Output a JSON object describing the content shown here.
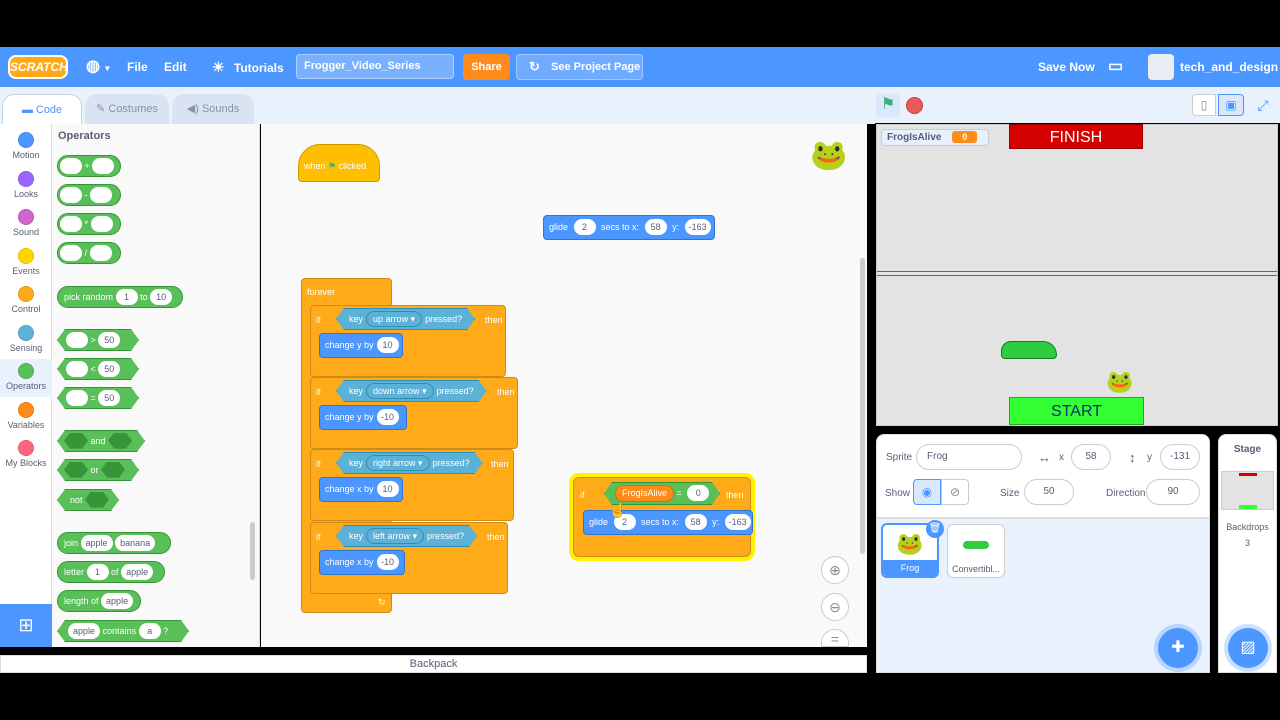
{
  "menubar": {
    "logo": "SCRATCH",
    "file": "File",
    "edit": "Edit",
    "tutorials": "Tutorials",
    "project_title": "Frogger_Video_Series",
    "share": "Share",
    "see_project": "See Project Page",
    "save_now": "Save Now",
    "username": "tech_and_design"
  },
  "tabs": {
    "code": "Code",
    "costumes": "Costumes",
    "sounds": "Sounds"
  },
  "categories": [
    {
      "label": "Motion",
      "color": "#4c97ff"
    },
    {
      "label": "Looks",
      "color": "#9966ff"
    },
    {
      "label": "Sound",
      "color": "#cf63cf"
    },
    {
      "label": "Events",
      "color": "#ffd500"
    },
    {
      "label": "Control",
      "color": "#ffab19"
    },
    {
      "label": "Sensing",
      "color": "#5cb1d6"
    },
    {
      "label": "Operators",
      "color": "#59c059"
    },
    {
      "label": "Variables",
      "color": "#ff8c1a"
    },
    {
      "label": "My Blocks",
      "color": "#ff6680"
    }
  ],
  "palette": {
    "title": "Operators",
    "plus": "+",
    "minus": "-",
    "times": "*",
    "divide": "/",
    "pick_random": "pick random",
    "pick_from": "1",
    "pick_to_word": "to",
    "pick_to": "10",
    "gt": ">",
    "gt_val": "50",
    "lt": "<",
    "lt_val": "50",
    "eq": "=",
    "eq_val": "50",
    "and": "and",
    "or": "or",
    "not": "not",
    "join": "join",
    "join_a": "apple",
    "join_b": "banana",
    "letter": "letter",
    "letter_n": "1",
    "letter_of": "of",
    "letter_word": "apple",
    "length_of": "length of",
    "length_word": "apple",
    "contains_word": "apple",
    "contains": "contains",
    "contains_a": "a",
    "contains_q": "?"
  },
  "script": {
    "when_flag": "when",
    "clicked": "clicked",
    "glide": "glide",
    "glide_secs": "2",
    "secs_to_x": "secs to x:",
    "glide_x": "58",
    "y_label": "y:",
    "glide_y": "-163",
    "forever": "forever",
    "if": "if",
    "then": "then",
    "key": "key",
    "pressed": "pressed?",
    "up_arrow": "up arrow",
    "down_arrow": "down arrow",
    "right_arrow": "right arrow",
    "left_arrow": "left arrow",
    "change_y_by": "change y by",
    "change_x_by": "change x by",
    "up_val": "10",
    "down_val": "-10",
    "right_val": "10",
    "left_val": "-10",
    "frog_alive": "FrogIsAlive",
    "equals": "=",
    "alive_val": "0",
    "glide2_secs": "2",
    "glide2_x": "58",
    "glide2_y": "-163"
  },
  "backpack": "Backpack",
  "stage": {
    "monitor_label": "FrogIsAlive",
    "monitor_value": "0",
    "finish": "FINISH",
    "start": "START"
  },
  "sprite_info": {
    "sprite_label": "Sprite",
    "sprite_name": "Frog",
    "x_label": "x",
    "x_value": "58",
    "y_label": "y",
    "y_value": "-131",
    "show_label": "Show",
    "size_label": "Size",
    "size_value": "50",
    "direction_label": "Direction",
    "direction_value": "90"
  },
  "sprites": [
    {
      "name": "Frog"
    },
    {
      "name": "Convertibl..."
    }
  ],
  "stage_panel": {
    "title": "Stage",
    "backdrops_label": "Backdrops",
    "backdrops_count": "3"
  }
}
